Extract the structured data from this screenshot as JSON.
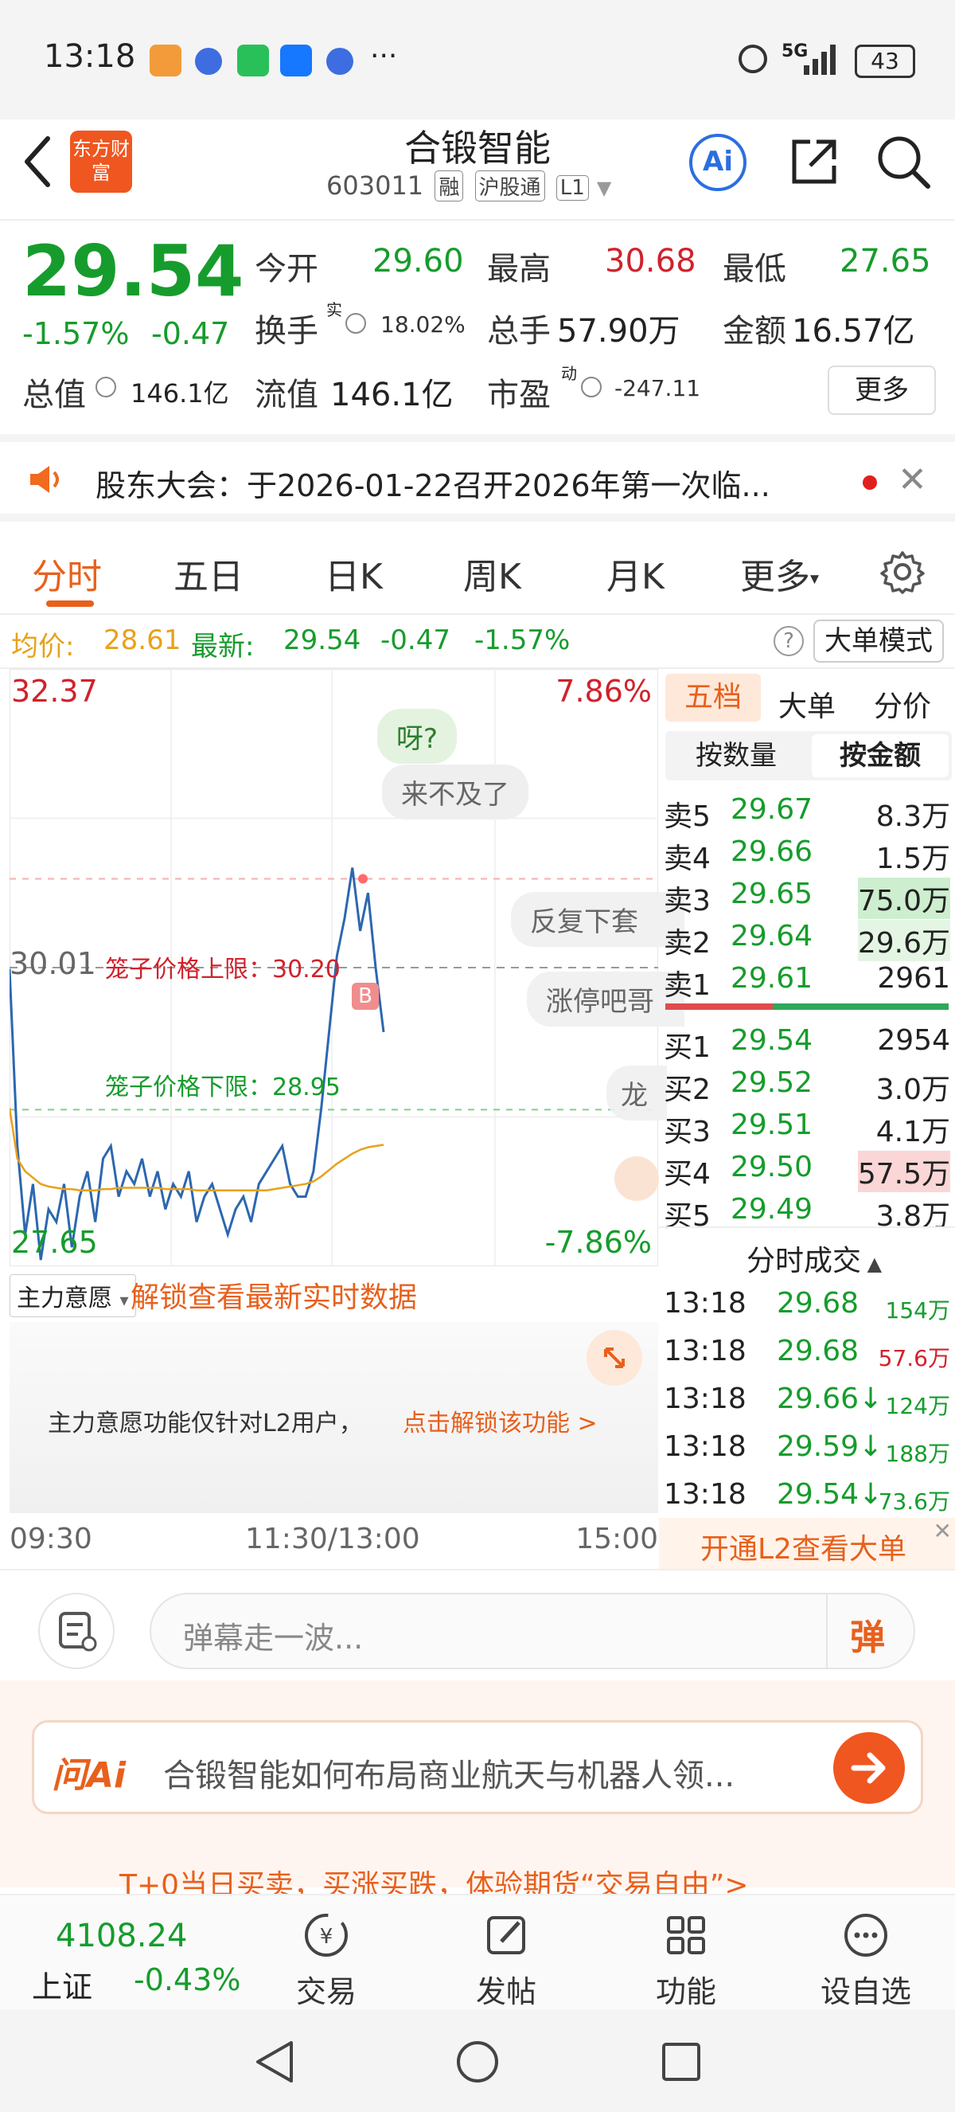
{
  "status_bar": {
    "time": "13:18",
    "network": "5G",
    "battery": "43"
  },
  "header": {
    "logo_text": "东方财富",
    "stock_name": "合锻智能",
    "stock_code": "603011",
    "tags": [
      "融",
      "沪股通",
      "L1"
    ],
    "ai_label": "Ai"
  },
  "quote": {
    "price": "29.54",
    "change_pct": "-1.57%",
    "change": "-0.47",
    "open_label": "今开",
    "open": "29.60",
    "high_label": "最高",
    "high": "30.68",
    "low_label": "最低",
    "low": "27.65",
    "turnover_label": "换手",
    "turnover_sup": "实",
    "turnover": "18.02%",
    "volume_label": "总手",
    "volume": "57.90万",
    "amount_label": "金额",
    "amount": "16.57亿",
    "mktcap_label": "总值",
    "mktcap": "146.1亿",
    "float_label": "流值",
    "float_cap": "146.1亿",
    "pe_label": "市盈",
    "pe_sup": "动",
    "pe": "-247.11",
    "more_button": "更多"
  },
  "notice": {
    "text": "股东大会：于2026-01-22召开2026年第一次临..."
  },
  "tabs": [
    "分时",
    "五日",
    "日K",
    "周K",
    "月K",
    "更多"
  ],
  "info_line": {
    "avg_label": "均价:",
    "avg": "28.61",
    "latest_label": "最新:",
    "latest": "29.54",
    "change": "-0.47",
    "change_pct": "-1.57%",
    "mode_button": "大单模式"
  },
  "chart": {
    "y_max": "32.37",
    "y_max_pct": "7.86%",
    "y_min": "27.65",
    "y_min_pct": "-7.86%",
    "prev_close": "30.01",
    "upper_limit_label": "笼子价格上限：30.20",
    "lower_limit_label": "笼子价格下限：28.95",
    "danmu": [
      "呀?",
      "来不及了",
      "反复下套",
      "涨停吧哥",
      "龙"
    ],
    "marker": "B",
    "x_labels": [
      "09:30",
      "11:30/13:00",
      "15:00"
    ]
  },
  "chart_data": {
    "type": "line",
    "ylim": [
      27.65,
      32.37
    ],
    "series": [
      {
        "name": "",
        "values": [
          30.0,
          28.6,
          27.9,
          28.3,
          27.7,
          28.1,
          28.0,
          28.3,
          27.8,
          28.2,
          28.4,
          28.0,
          28.5,
          28.6,
          28.2,
          28.4,
          28.3,
          28.5,
          28.2,
          28.4,
          28.1,
          28.3,
          28.2,
          28.4,
          28.0,
          28.2,
          28.3,
          28.1,
          27.9,
          28.1,
          28.2,
          28.0,
          28.3,
          28.4,
          28.5,
          28.6,
          28.3,
          28.2,
          28.2,
          28.4,
          28.9,
          29.5,
          30.1,
          30.4,
          30.8,
          30.3,
          30.6,
          30.0,
          29.5
        ]
      },
      {
        "name": "",
        "values": [
          28.9,
          28.5,
          28.4,
          28.35,
          28.3,
          28.28,
          28.27,
          28.26,
          28.26,
          28.25,
          28.25,
          28.25,
          28.26,
          28.26,
          28.27,
          28.27,
          28.27,
          28.27,
          28.27,
          28.27,
          28.26,
          28.26,
          28.26,
          28.26,
          28.25,
          28.25,
          28.25,
          28.25,
          28.25,
          28.25,
          28.25,
          28.25,
          28.25,
          28.25,
          28.26,
          28.27,
          28.28,
          28.29,
          28.3,
          28.32,
          28.36,
          28.41,
          28.46,
          28.5,
          28.54,
          28.57,
          28.59,
          28.6,
          28.61
        ]
      }
    ]
  },
  "main_force": {
    "dropdown": "主力意愿",
    "unlock_text": "解锁查看最新实时数据",
    "notice": "主力意愿功能仅针对L2用户，",
    "notice_link": "点击解锁该功能 >"
  },
  "order_book": {
    "tabs": [
      "五档",
      "大单",
      "分价"
    ],
    "subtabs": [
      "按数量",
      "按金额"
    ],
    "asks": [
      {
        "label": "卖5",
        "price": "29.67",
        "vol": "8.3万"
      },
      {
        "label": "卖4",
        "price": "29.66",
        "vol": "1.5万"
      },
      {
        "label": "卖3",
        "price": "29.65",
        "vol": "75.0万"
      },
      {
        "label": "卖2",
        "price": "29.64",
        "vol": "29.6万"
      },
      {
        "label": "卖1",
        "price": "29.61",
        "vol": "2961"
      }
    ],
    "bids": [
      {
        "label": "买1",
        "price": "29.54",
        "vol": "2954"
      },
      {
        "label": "买2",
        "price": "29.52",
        "vol": "3.0万"
      },
      {
        "label": "买3",
        "price": "29.51",
        "vol": "4.1万"
      },
      {
        "label": "买4",
        "price": "29.50",
        "vol": "57.5万"
      },
      {
        "label": "买5",
        "price": "29.49",
        "vol": "3.8万"
      }
    ],
    "trades_title": "分时成交",
    "trades": [
      {
        "time": "13:18",
        "price": "29.68",
        "vol": "154万",
        "color": "#169c2c"
      },
      {
        "time": "13:18",
        "price": "29.68",
        "vol": "57.6万",
        "color": "#d0222b"
      },
      {
        "time": "13:18",
        "price": "29.66↓",
        "vol": "124万",
        "color": "#169c2c"
      },
      {
        "time": "13:18",
        "price": "29.59↓",
        "vol": "188万",
        "color": "#169c2c"
      },
      {
        "time": "13:18",
        "price": "29.54↓",
        "vol": "73.6万",
        "color": "#169c2c"
      }
    ],
    "l2_banner": "开通L2查看大单"
  },
  "comment": {
    "placeholder": "弹幕走一波...",
    "danmu_button": "弹"
  },
  "ai_bar": {
    "brand": "问Ai",
    "query": "合锻智能如何布局商业航天与机器人领...",
    "ticker_partial": "T+0当日买卖，买涨买跌，体验期货“交易自由”>"
  },
  "bottom_nav": {
    "index_value": "4108.24",
    "index_name": "上证",
    "index_change": "-0.43%",
    "items": [
      "交易",
      "发帖",
      "功能",
      "设自选"
    ]
  }
}
